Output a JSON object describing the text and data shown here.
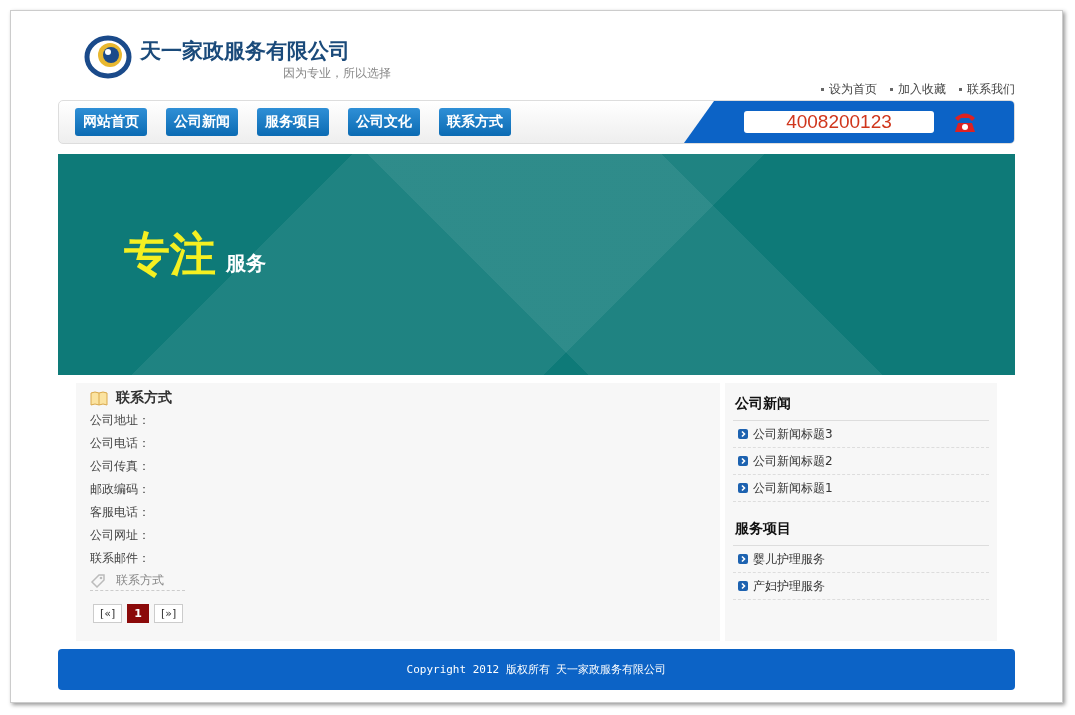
{
  "header": {
    "company": "天一家政服务有限公司",
    "slogan": "因为专业，所以选择",
    "top_links": [
      "设为首页",
      "加入收藏",
      "联系我们"
    ]
  },
  "nav": {
    "items": [
      {
        "label": "网站首页",
        "selected": false
      },
      {
        "label": "公司新闻",
        "selected": false
      },
      {
        "label": "服务项目",
        "selected": false
      },
      {
        "label": "公司文化",
        "selected": false
      },
      {
        "label": "联系方式",
        "selected": false
      }
    ],
    "phone": "4008200123"
  },
  "banner": {
    "headline": "专注",
    "subline": "服务"
  },
  "contact": {
    "title": "联系方式",
    "fields": [
      "公司地址：",
      "公司电话：",
      "公司传真：",
      "邮政编码：",
      "客服电话：",
      "公司网址：",
      "联系邮件："
    ],
    "tag": "联系方式",
    "pager": [
      {
        "label": "[«]",
        "selected": false
      },
      {
        "label": "1",
        "selected": true
      },
      {
        "label": "[»]",
        "selected": false
      }
    ]
  },
  "sidebar": [
    {
      "title": "公司新闻",
      "items": [
        "公司新闻标题3",
        "公司新闻标题2",
        "公司新闻标题1"
      ]
    },
    {
      "title": "服务项目",
      "items": [
        "婴儿护理服务",
        "产妇护理服务"
      ]
    }
  ],
  "footer": {
    "text": "Copyright 2012 版权所有 天一家政服务有限公司"
  }
}
